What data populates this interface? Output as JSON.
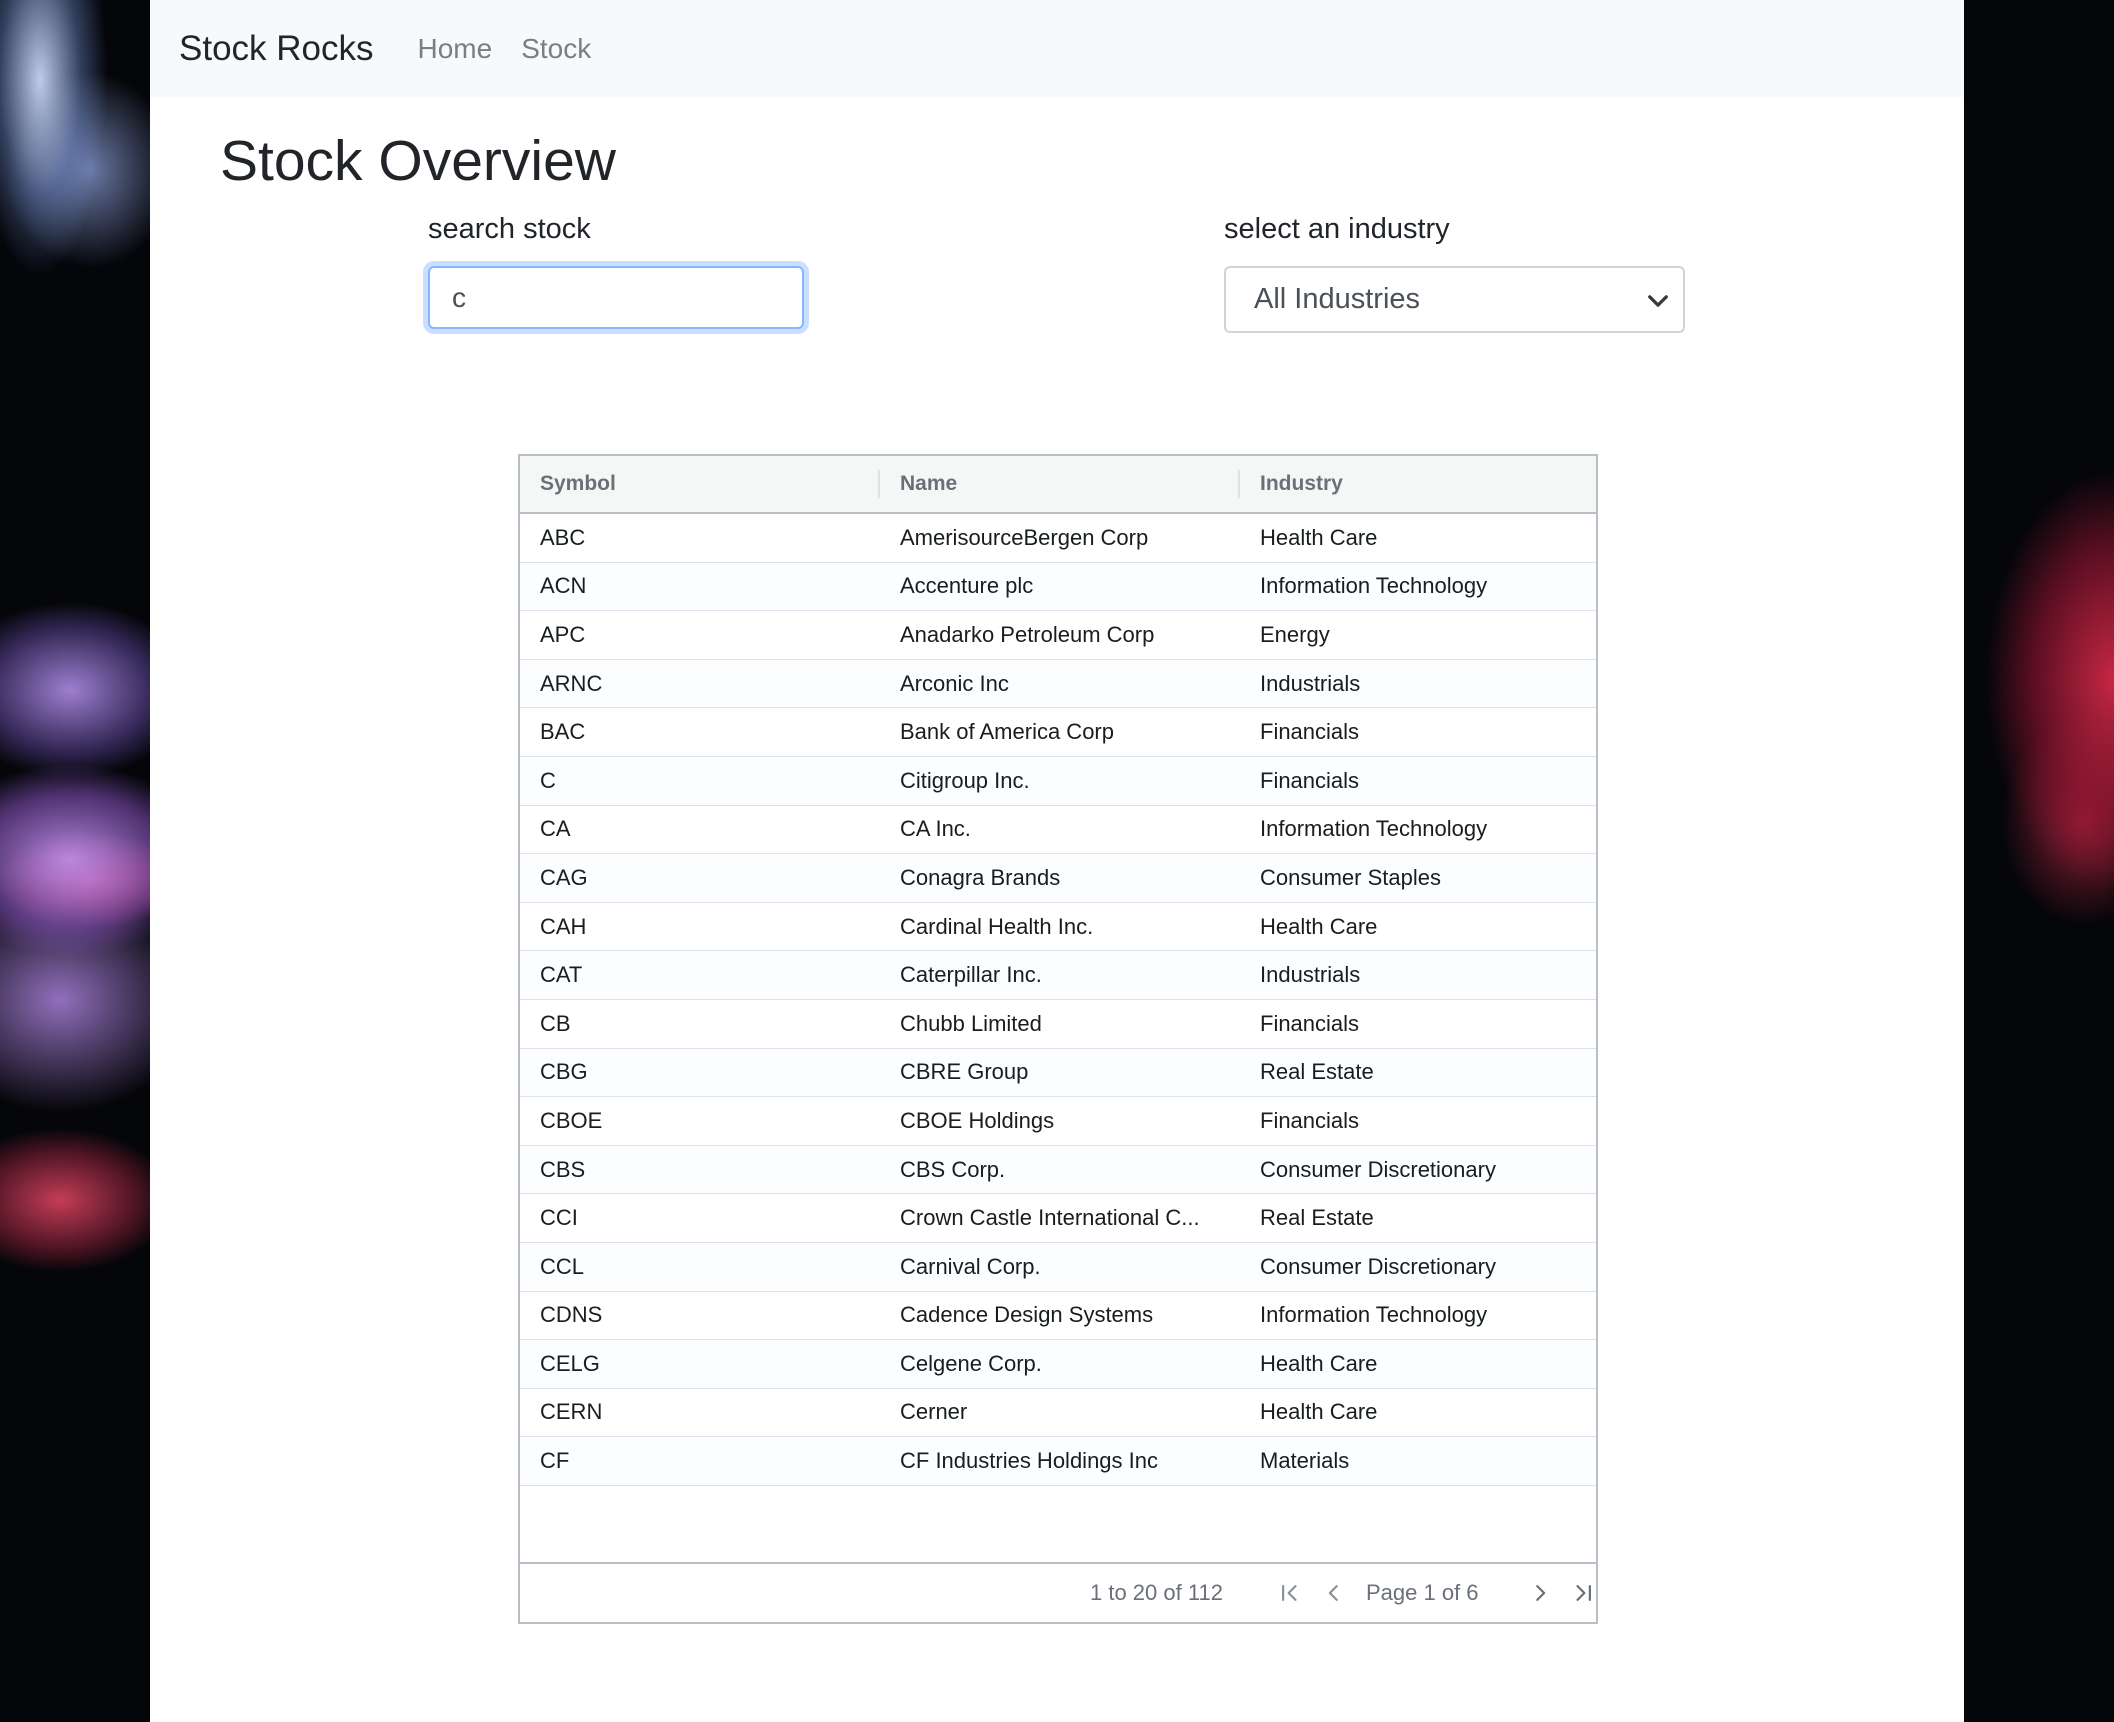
{
  "nav": {
    "brand": "Stock Rocks",
    "links": [
      "Home",
      "Stock"
    ]
  },
  "page_title": "Stock Overview",
  "search": {
    "label": "search stock",
    "value": "c"
  },
  "industry": {
    "label": "select an industry",
    "selected": "All Industries"
  },
  "table": {
    "columns": [
      "Symbol",
      "Name",
      "Industry"
    ],
    "rows": [
      [
        "ABC",
        "AmerisourceBergen Corp",
        "Health Care"
      ],
      [
        "ACN",
        "Accenture plc",
        "Information Technology"
      ],
      [
        "APC",
        "Anadarko Petroleum Corp",
        "Energy"
      ],
      [
        "ARNC",
        "Arconic Inc",
        "Industrials"
      ],
      [
        "BAC",
        "Bank of America Corp",
        "Financials"
      ],
      [
        "C",
        "Citigroup Inc.",
        "Financials"
      ],
      [
        "CA",
        "CA Inc.",
        "Information Technology"
      ],
      [
        "CAG",
        "Conagra Brands",
        "Consumer Staples"
      ],
      [
        "CAH",
        "Cardinal Health Inc.",
        "Health Care"
      ],
      [
        "CAT",
        "Caterpillar Inc.",
        "Industrials"
      ],
      [
        "CB",
        "Chubb Limited",
        "Financials"
      ],
      [
        "CBG",
        "CBRE Group",
        "Real Estate"
      ],
      [
        "CBOE",
        "CBOE Holdings",
        "Financials"
      ],
      [
        "CBS",
        "CBS Corp.",
        "Consumer Discretionary"
      ],
      [
        "CCI",
        "Crown Castle International C...",
        "Real Estate"
      ],
      [
        "CCL",
        "Carnival Corp.",
        "Consumer Discretionary"
      ],
      [
        "CDNS",
        "Cadence Design Systems",
        "Information Technology"
      ],
      [
        "CELG",
        "Celgene Corp.",
        "Health Care"
      ],
      [
        "CERN",
        "Cerner",
        "Health Care"
      ],
      [
        "CF",
        "CF Industries Holdings Inc",
        "Materials"
      ]
    ]
  },
  "pagination": {
    "summary": "1 to 20 of 112",
    "page_label": "Page 1 of 6",
    "icons": [
      "first-page-icon",
      "previous-page-icon",
      "next-page-icon",
      "last-page-icon"
    ]
  },
  "colors": {
    "accent_focus": "#86b7fe",
    "navbar_bg": "#f8f9fa",
    "grid_border": "#babfc7"
  }
}
